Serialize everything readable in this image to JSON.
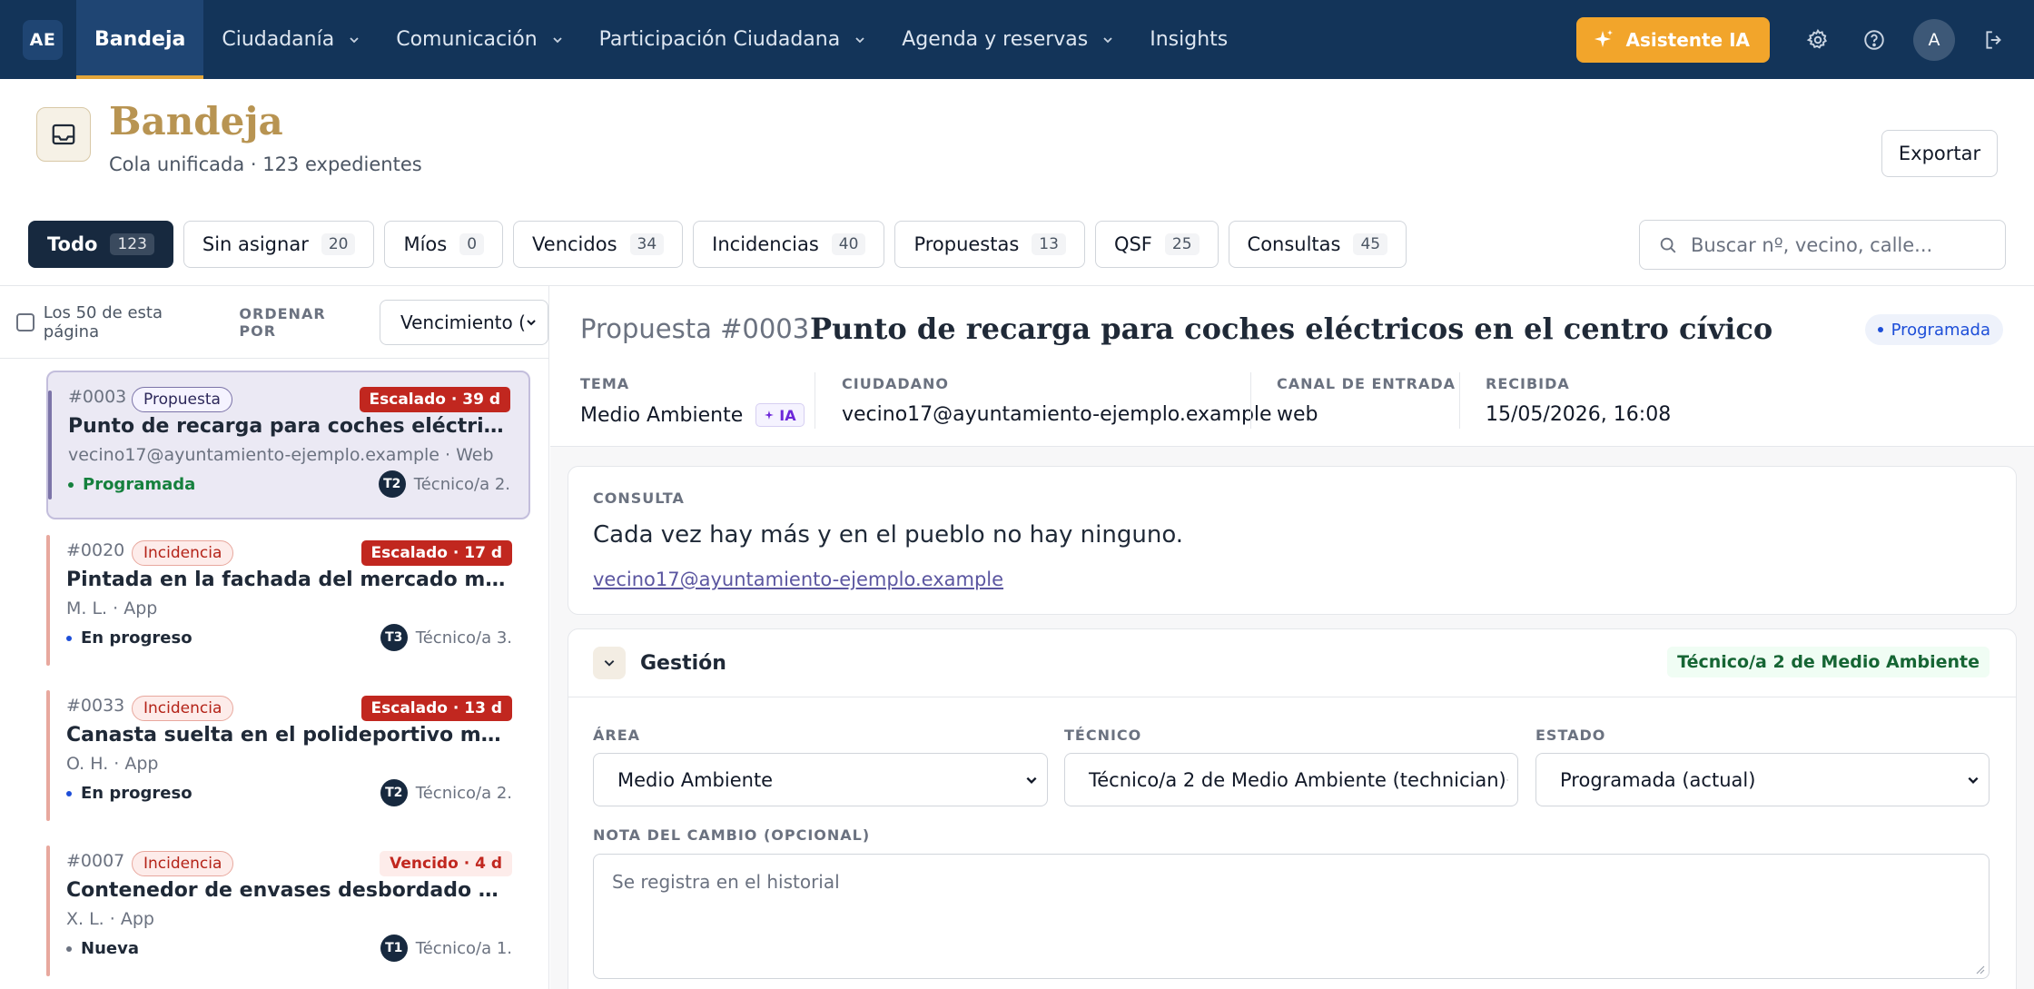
{
  "nav": {
    "logo": "AE",
    "items": [
      {
        "label": "Bandeja",
        "active": true,
        "dropdown": false
      },
      {
        "label": "Ciudadanía",
        "active": false,
        "dropdown": true
      },
      {
        "label": "Comunicación",
        "active": false,
        "dropdown": true
      },
      {
        "label": "Participación Ciudadana",
        "active": false,
        "dropdown": true
      },
      {
        "label": "Agenda y reservas",
        "active": false,
        "dropdown": true
      },
      {
        "label": "Insights",
        "active": false,
        "dropdown": false
      }
    ],
    "assistant_label": "Asistente IA",
    "avatar": "A",
    "icons": [
      "gear-icon",
      "help-icon",
      "logout-icon"
    ]
  },
  "header": {
    "title": "Bandeja",
    "subtitle": "Cola unificada · 123 expedientes",
    "export_label": "Exportar"
  },
  "filters": [
    {
      "label": "Todo",
      "count": "123",
      "active": true
    },
    {
      "label": "Sin asignar",
      "count": "20",
      "active": false
    },
    {
      "label": "Míos",
      "count": "0",
      "active": false
    },
    {
      "label": "Vencidos",
      "count": "34",
      "active": false
    },
    {
      "label": "Incidencias",
      "count": "40",
      "active": false
    },
    {
      "label": "Propuestas",
      "count": "13",
      "active": false
    },
    {
      "label": "QSF",
      "count": "25",
      "active": false
    },
    {
      "label": "Consultas",
      "count": "45",
      "active": false
    }
  ],
  "search": {
    "placeholder": "Buscar nº, vecino, calle..."
  },
  "list": {
    "select_all_label": "Los 50 de esta página",
    "order_label": "ORDENAR POR",
    "order_value": "Vencimiento (",
    "items": [
      {
        "id": "#0003",
        "type": "Propuesta",
        "status": "Escalado · 39 d",
        "title": "Punto de recarga para coches eléctricos en el centro cívico",
        "meta": "vecino17@ayuntamiento-ejemplo.example · Web",
        "state": "Programada",
        "tech_initials": "T2",
        "tech": "Técnico/a 2."
      },
      {
        "id": "#0020",
        "type": "Incidencia",
        "status": "Escalado · 17 d",
        "title": "Pintada en la fachada del mercado municipal",
        "meta": "M. L. · App",
        "state": "En progreso",
        "tech_initials": "T3",
        "tech": "Técnico/a 3."
      },
      {
        "id": "#0033",
        "type": "Incidencia",
        "status": "Escalado · 13 d",
        "title": "Canasta suelta en el polideportivo municipal",
        "meta": "O. H. · App",
        "state": "En progreso",
        "tech_initials": "T2",
        "tech": "Técnico/a 2."
      },
      {
        "id": "#0007",
        "type": "Incidencia",
        "status": "Vencido · 4 d",
        "title": "Contenedor de envases desbordado en camino vecinal",
        "meta": "X. L. · App",
        "state": "Nueva",
        "tech_initials": "T1",
        "tech": "Técnico/a 1."
      }
    ]
  },
  "detail": {
    "type_number": "Propuesta #0003",
    "title": "Punto de recarga para coches eléctricos en el centro cívico",
    "badge": "Programada",
    "meta": [
      {
        "label": "TEMA",
        "value": "Medio Ambiente",
        "ai_badge": "IA"
      },
      {
        "label": "CIUDADANO",
        "value": "vecino17@ayuntamiento-ejemplo.example"
      },
      {
        "label": "CANAL DE ENTRADA",
        "value": "web"
      },
      {
        "label": "RECIBIDA",
        "value": "15/05/2026, 16:08"
      }
    ],
    "consulta": {
      "label": "CONSULTA",
      "text": "Cada vez hay más y en el pueblo no hay ninguno.",
      "email": "vecino17@ayuntamiento-ejemplo.example"
    },
    "gestion": {
      "title": "Gestión",
      "assigned_badge": "Técnico/a 2 de Medio Ambiente",
      "area_label": "ÁREA",
      "area_value": "Medio Ambiente",
      "tecnico_label": "TÉCNICO",
      "tecnico_value": "Técnico/a 2 de Medio Ambiente (technician)",
      "estado_label": "ESTADO",
      "estado_value": "Programada (actual)",
      "nota_label": "NOTA DEL CAMBIO (OPCIONAL)",
      "nota_placeholder": "Se registra en el historial"
    }
  },
  "colors": {
    "nav_bg": "#133459",
    "accent_gold": "#b89452",
    "assistant_orange": "#f2a52b",
    "escalado_red": "#c1271f",
    "propuesta_purple": "#7c74a8",
    "incidencia_salmon": "#e8a89e",
    "state_green": "#15803d",
    "state_blue": "#1d4ed8"
  }
}
